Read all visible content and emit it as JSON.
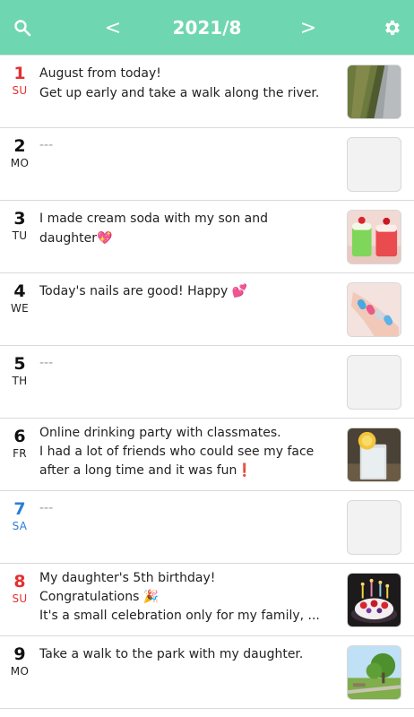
{
  "header": {
    "title": "2021/8",
    "prev_label": "<",
    "next_label": ">",
    "bg_color": "#6fd6b2"
  },
  "entries": [
    {
      "day": "1",
      "dow": "SU",
      "lines": [
        "August from today!",
        "Get up early and take a walk along the river."
      ],
      "thumb": "river-photo"
    },
    {
      "day": "2",
      "dow": "MO",
      "lines": [
        "---"
      ],
      "thumb": "empty"
    },
    {
      "day": "3",
      "dow": "TU",
      "lines": [
        "I made cream soda with my son and",
        "daughter💖"
      ],
      "thumb": "cream-soda-photo"
    },
    {
      "day": "4",
      "dow": "WE",
      "lines": [
        "Today's nails are good!  Happy 💕"
      ],
      "thumb": "nails-photo"
    },
    {
      "day": "5",
      "dow": "TH",
      "lines": [
        "---"
      ],
      "thumb": "empty"
    },
    {
      "day": "6",
      "dow": "FR",
      "lines": [
        "Online drinking party with classmates.",
        "I had a lot of friends who could see my face",
        "after a long time and it was fun❗"
      ],
      "thumb": "drink-photo"
    },
    {
      "day": "7",
      "dow": "SA",
      "lines": [
        "---"
      ],
      "thumb": "empty"
    },
    {
      "day": "8",
      "dow": "SU",
      "lines": [
        "My daughter's 5th birthday!",
        "Congratulations 🎉",
        "It's a small celebration only for my family, ..."
      ],
      "thumb": "birthday-cake-photo"
    },
    {
      "day": "9",
      "dow": "MO",
      "lines": [
        "Take a walk to the park with my daughter."
      ],
      "thumb": "park-photo"
    }
  ]
}
